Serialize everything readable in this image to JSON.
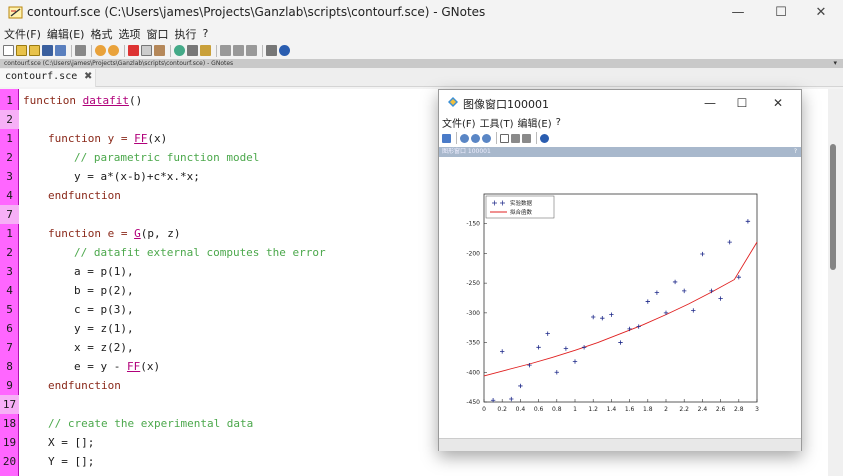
{
  "window": {
    "title": "contourf.sce (C:\\Users\\james\\Projects\\Ganzlab\\scripts\\contourf.sce) - GNotes",
    "min": "—",
    "max": "☐",
    "close": "✕"
  },
  "menu": [
    "文件(F)",
    "编辑(E)",
    "格式",
    "选项",
    "窗口",
    "执行",
    "?"
  ],
  "path_bar": {
    "text": "contourf.sce (C:\\Users\\james\\Projects\\Ganzlab\\scripts\\contourf.sce) - GNotes",
    "menu": "▾"
  },
  "tab": {
    "label": "contourf.sce",
    "close": "✖"
  },
  "code": {
    "lines": [
      {
        "num": "1",
        "hl": false
      },
      {
        "num": "2",
        "hl": true
      },
      {
        "num": "1",
        "hl": false
      },
      {
        "num": "2",
        "hl": false
      },
      {
        "num": "3",
        "hl": false
      },
      {
        "num": "4",
        "hl": false
      },
      {
        "num": "7",
        "hl": true
      },
      {
        "num": "1",
        "hl": false
      },
      {
        "num": "2",
        "hl": false
      },
      {
        "num": "3",
        "hl": false
      },
      {
        "num": "4",
        "hl": false
      },
      {
        "num": "5",
        "hl": false
      },
      {
        "num": "6",
        "hl": false
      },
      {
        "num": "7",
        "hl": false
      },
      {
        "num": "8",
        "hl": false
      },
      {
        "num": "9",
        "hl": false
      },
      {
        "num": "17",
        "hl": true
      },
      {
        "num": "18",
        "hl": false
      },
      {
        "num": "19",
        "hl": false
      },
      {
        "num": "20",
        "hl": false
      }
    ],
    "t": {
      "function": "function ",
      "datafit": "datafit",
      "paren_empty": "()",
      "fn_y": "function y = ",
      "ff": "FF",
      "x_arg": "(x)",
      "cm_param": "// parametric function model",
      "y_assign": "y = a*(x-b)+c*x.*x;",
      "endfunction": "endfunction",
      "fn_e": "function e = ",
      "g": "G",
      "pz_args": "(p, z)",
      "cm_datafit": "// datafit external computes the error",
      "a_assign": "a = p(1),",
      "b_assign": "b = p(2),",
      "c_assign": "c = p(3),",
      "yz_assign": "y = z(1),",
      "xz_assign": "x = z(2),",
      "e_assign": "e = y - ",
      "cm_create": "// create the experimental data",
      "x_init": "X = [];",
      "y_init": "Y = [];"
    }
  },
  "graphic": {
    "title": "图像窗口100001",
    "min": "—",
    "max": "☐",
    "close": "✕",
    "menu": [
      "文件(F)",
      "工具(T)",
      "编辑(E)",
      "?"
    ],
    "strip_text": "图形窗口 100001",
    "strip_q": "?"
  },
  "colors": {
    "gutter": "#ff66ff",
    "gutter_highlight": "#f7b0f7",
    "keyword": "#8b2a1b",
    "function_name": "#b0007a",
    "comment": "#4ca84c",
    "data_marker": "#1f2a8a",
    "fit_line": "#e02020"
  },
  "chart_data": {
    "type": "scatter",
    "xlim": [
      0,
      3
    ],
    "ylim": [
      -450,
      -100
    ],
    "xticks": [
      "0",
      "0.2",
      "0.4",
      "0.6",
      "0.8",
      "1",
      "1.2",
      "1.4",
      "1.6",
      "1.8",
      "2",
      "2.2",
      "2.4",
      "2.6",
      "2.8",
      "3"
    ],
    "yticks": [
      "-150",
      "-200",
      "-250",
      "-300",
      "-350",
      "-400",
      "-450"
    ],
    "legend": [
      "实验数据",
      "拟合函数"
    ],
    "legend_position": "top-left",
    "series": [
      {
        "name": "实验数据",
        "type": "scatter",
        "marker": "+",
        "x": [
          0.1,
          0.2,
          0.3,
          0.4,
          0.5,
          0.6,
          0.7,
          0.8,
          0.9,
          1.0,
          1.1,
          1.2,
          1.3,
          1.4,
          1.5,
          1.6,
          1.7,
          1.8,
          1.9,
          2.0,
          2.1,
          2.2,
          2.3,
          2.4,
          2.5,
          2.6,
          2.7,
          2.8,
          2.9
        ],
        "y": [
          -447,
          -365,
          -445,
          -423,
          -388,
          -358,
          -335,
          -400,
          -360,
          -382,
          -358,
          -307,
          -309,
          -303,
          -350,
          -327,
          -323,
          -281,
          -266,
          -300,
          -248,
          -263,
          -296,
          -201,
          -263,
          -276,
          -181,
          -240,
          -146
        ]
      },
      {
        "name": "拟合函数",
        "type": "line",
        "x": [
          0,
          0.25,
          0.5,
          0.75,
          1.0,
          1.25,
          1.5,
          1.75,
          2.0,
          2.25,
          2.5,
          2.75,
          3.0
        ],
        "y": [
          -406,
          -396,
          -386,
          -375,
          -363,
          -350,
          -335,
          -320,
          -303,
          -285,
          -265,
          -244,
          -181
        ]
      }
    ]
  }
}
